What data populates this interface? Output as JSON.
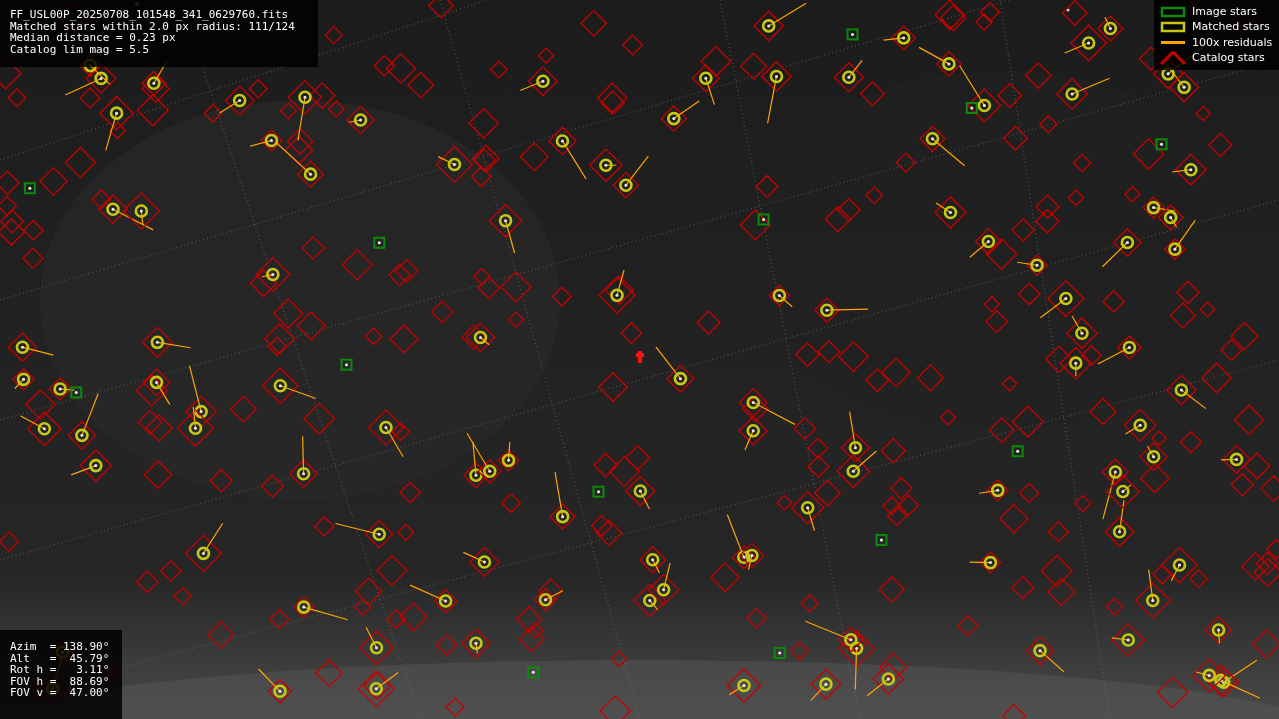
{
  "info_panel": {
    "lines": [
      "FF_USL00P_20250708_101548_341_0629760.fits",
      "Matched stars within 2.0 px radius: 111/124",
      "Median distance = 0.23 px",
      "Catalog lim mag = 5.5"
    ]
  },
  "pointing_panel": {
    "lines": [
      "Azim  = 138.90°",
      "Alt   =  45.79°",
      "Rot h =   3.11°",
      "FOV h =  88.69°",
      "FOV v =  47.00°"
    ]
  },
  "legend": [
    {
      "kind": "image",
      "label": "Image stars",
      "color": "#0b8a0b"
    },
    {
      "kind": "matched",
      "label": "Matched stars",
      "color": "#c8c814"
    },
    {
      "kind": "residual",
      "label": "100x residuals",
      "color": "#ffa500"
    },
    {
      "kind": "catalog",
      "label": "Catalog stars",
      "color": "#c80000"
    }
  ]
}
